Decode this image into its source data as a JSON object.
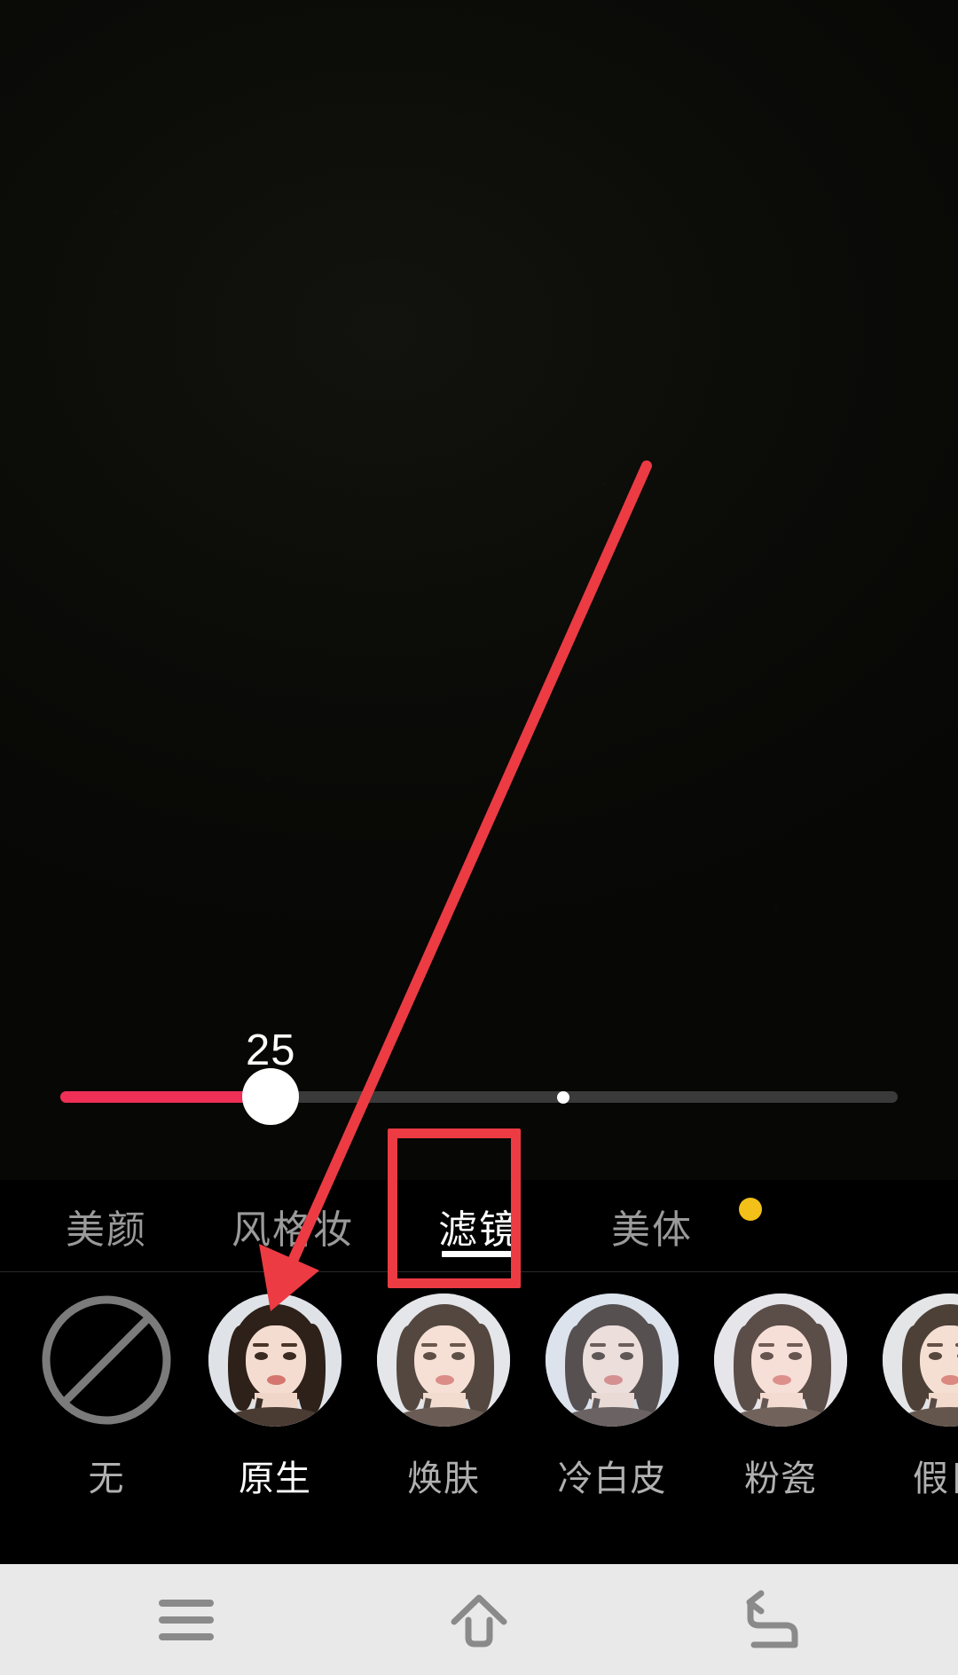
{
  "app": {
    "screen_name": "beauty-camera-filter-panel",
    "background_color": "#0a0a08"
  },
  "preview": {
    "description_label": ""
  },
  "slider": {
    "name": "filter-intensity-slider",
    "value": "25",
    "value_number": 25,
    "min": 0,
    "max": 100,
    "fill_color": "#ef2f56",
    "track_color": "#3a3a3a",
    "thumb_color": "#ffffff",
    "center_marker_color": "#ffffff"
  },
  "tabs": {
    "active_index": 2,
    "active_color": "#ffffff",
    "inactive_color": "#9a9a9a",
    "badge_color": "#f2c018",
    "items": [
      {
        "label": "美颜",
        "active": false,
        "badge": false
      },
      {
        "label": "风格妆",
        "active": false,
        "badge": false
      },
      {
        "label": "滤镜",
        "active": true,
        "badge": false
      },
      {
        "label": "美体",
        "active": false,
        "badge": true
      }
    ]
  },
  "filters": {
    "selected_index": 1,
    "selected_ring_color": "#f0b429",
    "items": [
      {
        "label": "无",
        "icon": "no-filter-icon",
        "selected": false,
        "tone": "none"
      },
      {
        "label": "原生",
        "icon": "filter-thumbnail",
        "selected": true,
        "tone": "t-yuansheng"
      },
      {
        "label": "焕肤",
        "icon": "filter-thumbnail",
        "selected": false,
        "tone": "t-huanfu"
      },
      {
        "label": "冷白皮",
        "icon": "filter-thumbnail",
        "selected": false,
        "tone": "t-lengbaipi"
      },
      {
        "label": "粉瓷",
        "icon": "filter-thumbnail",
        "selected": false,
        "tone": "t-fenci"
      },
      {
        "label": "假日",
        "icon": "filter-thumbnail",
        "selected": false,
        "tone": "t-jiari"
      }
    ]
  },
  "annotation": {
    "highlight_color": "#ec3b43",
    "arrow_color": "#ec3b43",
    "box_target_label": "滤镜",
    "arrow_target_label": "原生"
  },
  "navbar": {
    "background_color": "#e9e9e9",
    "icon_color": "#8a8a8a",
    "buttons": [
      {
        "name": "recents-icon",
        "label": ""
      },
      {
        "name": "home-icon",
        "label": ""
      },
      {
        "name": "back-icon",
        "label": ""
      }
    ]
  }
}
